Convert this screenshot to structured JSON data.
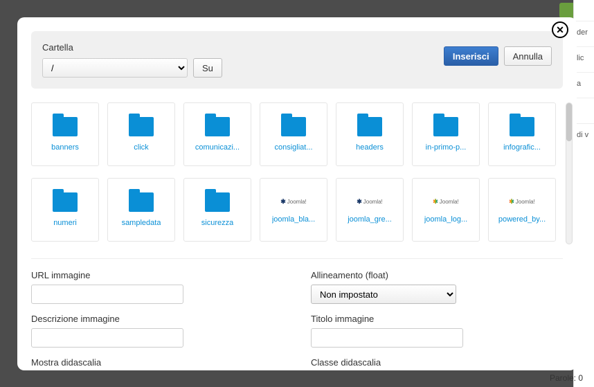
{
  "toolbar": {
    "folder_label": "Cartella",
    "path_value": "/",
    "up_label": "Su",
    "insert_label": "Inserisci",
    "cancel_label": "Annulla"
  },
  "items": [
    {
      "type": "folder",
      "label": "banners"
    },
    {
      "type": "folder",
      "label": "click"
    },
    {
      "type": "folder",
      "label": "comunicazi..."
    },
    {
      "type": "folder",
      "label": "consigliat..."
    },
    {
      "type": "folder",
      "label": "headers"
    },
    {
      "type": "folder",
      "label": "in-primo-p..."
    },
    {
      "type": "folder",
      "label": "infografic..."
    },
    {
      "type": "folder",
      "label": "numeri"
    },
    {
      "type": "folder",
      "label": "sampledata"
    },
    {
      "type": "folder",
      "label": "sicurezza"
    },
    {
      "type": "image",
      "label": "joomla_bla...",
      "variant": "mono"
    },
    {
      "type": "image",
      "label": "joomla_gre...",
      "variant": "mono"
    },
    {
      "type": "image",
      "label": "joomla_log...",
      "variant": "color"
    },
    {
      "type": "image",
      "label": "powered_by...",
      "variant": "color"
    }
  ],
  "form": {
    "url_label": "URL immagine",
    "align_label": "Allineamento (float)",
    "align_value": "Non impostato",
    "desc_label": "Descrizione immagine",
    "title_label": "Titolo immagine",
    "caption_show_label": "Mostra didascalia",
    "caption_class_label": "Classe didascalia"
  },
  "footer": {
    "words": "Parole: 0"
  },
  "sidebar_hints": [
    "der",
    "lic",
    "a",
    "",
    "di v"
  ],
  "thumb_text": "Joomla!"
}
